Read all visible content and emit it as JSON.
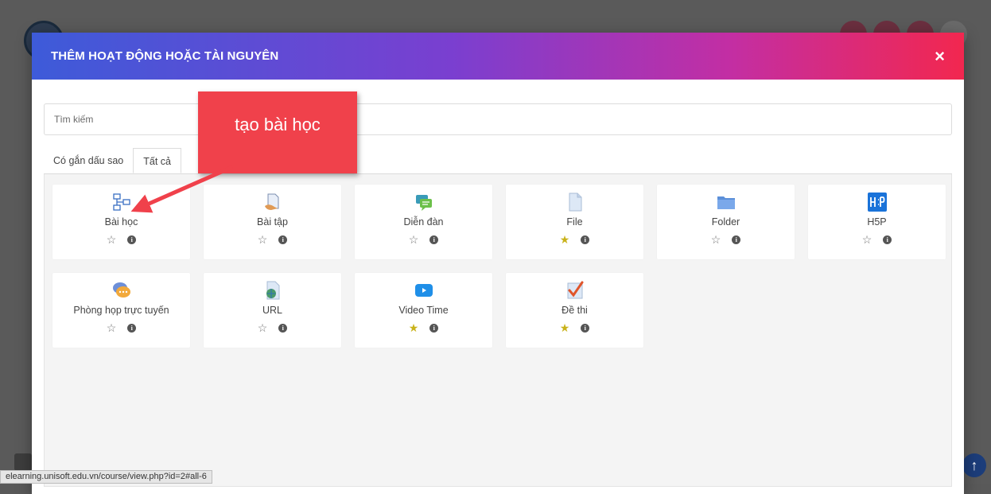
{
  "modal": {
    "title": "THÊM HOẠT ĐỘNG HOẶC TÀI NGUYÊN",
    "close": "×",
    "search_placeholder": "Tìm kiếm",
    "tabs": [
      {
        "label": "Có gắn dấu sao",
        "active": false
      },
      {
        "label": "Tất cả",
        "active": true
      }
    ],
    "activities": [
      {
        "label": "Bài học",
        "icon": "lesson-icon",
        "starred": false
      },
      {
        "label": "Bài tập",
        "icon": "assignment-icon",
        "starred": false
      },
      {
        "label": "Diễn đàn",
        "icon": "forum-icon",
        "starred": false
      },
      {
        "label": "File",
        "icon": "file-icon",
        "starred": true
      },
      {
        "label": "Folder",
        "icon": "folder-icon",
        "starred": false
      },
      {
        "label": "H5P",
        "icon": "h5p-icon",
        "starred": false
      },
      {
        "label": "Phòng họp trực tuyến",
        "icon": "meeting-icon",
        "starred": false
      },
      {
        "label": "URL",
        "icon": "url-icon",
        "starred": false
      },
      {
        "label": "Video Time",
        "icon": "video-icon",
        "starred": true
      },
      {
        "label": "Đề thi",
        "icon": "quiz-icon",
        "starred": true
      }
    ],
    "star_empty": "☆",
    "star_filled": "★",
    "info_glyph": "i"
  },
  "callout": {
    "text": "tạo bài học"
  },
  "status_url": "elearning.unisoft.edu.vn/course/view.php?id=2#all-6",
  "scroll_top_glyph": "↑",
  "colors": {
    "accent_start": "#3d5bd9",
    "accent_end": "#f2274f",
    "callout": "#f0414b",
    "star": "#c9b21a"
  }
}
